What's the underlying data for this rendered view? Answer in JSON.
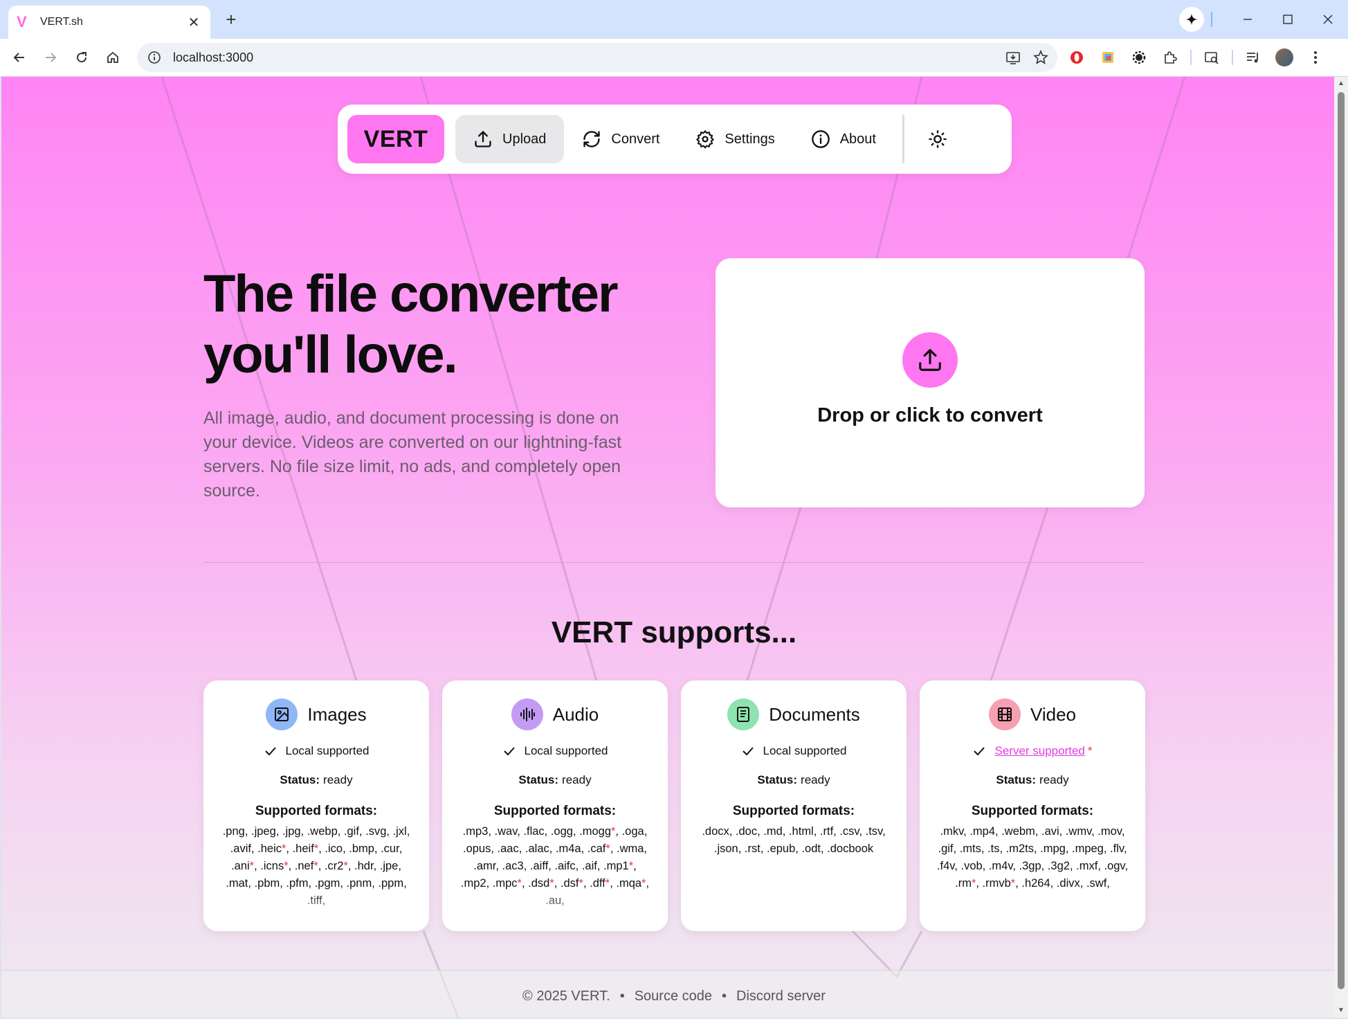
{
  "browser": {
    "tab_title": "VERT.sh",
    "tab_favicon": "V",
    "tab_close": "✕",
    "new_tab": "+",
    "url": "localhost:3000"
  },
  "nav": {
    "logo": "VERT",
    "items": [
      {
        "label": "Upload",
        "icon": "upload-icon",
        "active": true
      },
      {
        "label": "Convert",
        "icon": "refresh-icon"
      },
      {
        "label": "Settings",
        "icon": "gear-icon"
      },
      {
        "label": "About",
        "icon": "info-icon"
      }
    ],
    "theme_icon": "sun-icon"
  },
  "hero": {
    "title_line1": "The file converter",
    "title_line2": "you'll love.",
    "description": "All image, audio, and document processing is done on your device. Videos are converted on our lightning-fast servers. No file size limit, no ads, and completely open source."
  },
  "dropzone": {
    "label": "Drop or click to convert",
    "icon": "upload-icon"
  },
  "supports": {
    "title": "VERT supports...",
    "status_label": "Status:",
    "formats_label": "Supported formats:",
    "cards": [
      {
        "title": "Images",
        "icon": "image-icon",
        "icon_bg": "#8fb6f7",
        "support": "Local supported",
        "status": "ready",
        "formats": [
          ".png",
          ".jpeg",
          ".jpg",
          ".webp",
          ".gif",
          ".svg",
          ".jxl",
          ".avif",
          ".heic*",
          ".heif*",
          ".ico",
          ".bmp",
          ".cur",
          ".ani*",
          ".icns*",
          ".nef*",
          ".cr2*",
          ".hdr",
          ".jpe",
          ".mat",
          ".pbm",
          ".pfm",
          ".pgm",
          ".pnm",
          ".ppm",
          ".tiff,"
        ]
      },
      {
        "title": "Audio",
        "icon": "waveform-icon",
        "icon_bg": "#c39bf5",
        "support": "Local supported",
        "status": "ready",
        "formats": [
          ".mp3",
          ".wav",
          ".flac",
          ".ogg",
          ".mogg*",
          ".oga",
          ".opus",
          ".aac",
          ".alac",
          ".m4a",
          ".caf*",
          ".wma",
          ".amr",
          ".ac3",
          ".aiff",
          ".aifc",
          ".aif",
          ".mp1*",
          ".mp2",
          ".mpc*",
          ".dsd*",
          ".dsf*",
          ".dff*",
          ".mqa*",
          ".au,"
        ]
      },
      {
        "title": "Documents",
        "icon": "document-icon",
        "icon_bg": "#8fe3b0",
        "support": "Local supported",
        "status": "ready",
        "formats": [
          ".docx",
          ".doc",
          ".md",
          ".html",
          ".rtf",
          ".csv",
          ".tsv",
          ".json",
          ".rst",
          ".epub",
          ".odt",
          ".docbook"
        ]
      },
      {
        "title": "Video",
        "icon": "film-icon",
        "icon_bg": "#f4a0b0",
        "support": "Server supported",
        "support_asterisk": "*",
        "status": "ready",
        "formats": [
          ".mkv",
          ".mp4",
          ".webm",
          ".avi",
          ".wmv",
          ".mov",
          ".gif",
          ".mts",
          ".ts",
          ".m2ts",
          ".mpg",
          ".mpeg",
          ".flv",
          ".f4v",
          ".vob",
          ".m4v",
          ".3gp",
          ".3g2",
          ".mxf",
          ".ogv",
          ".rm*",
          ".rmvb*",
          ".h264",
          ".divx",
          ".swf,"
        ]
      }
    ]
  },
  "footer": {
    "copyright": "© 2025 VERT.",
    "separator": "•",
    "source": "Source code",
    "discord": "Discord server"
  },
  "colors": {
    "accent": "#ff77f0",
    "link": "#e23be0",
    "asterisk": "#e53b3b"
  }
}
